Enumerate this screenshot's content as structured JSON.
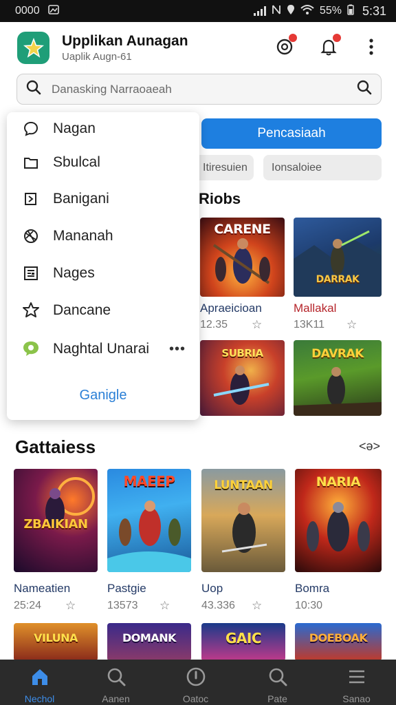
{
  "status_bar": {
    "left_text": "0000",
    "battery": "55%",
    "time": "5:31"
  },
  "header": {
    "title": "Upplikan Aunagan",
    "subtitle": "Uaplik Augn-61",
    "icons": [
      "record-icon",
      "bell-icon",
      "more-vertical-icon"
    ],
    "accent": "#1f9e78"
  },
  "search": {
    "placeholder": "Danasking Narraoaeah"
  },
  "menu": {
    "items": [
      {
        "label": "Nagan",
        "icon": "chat-bubble-icon"
      },
      {
        "label": "Sbulcal",
        "icon": "folder-icon"
      },
      {
        "label": "Banigani",
        "icon": "book-icon"
      },
      {
        "label": "Mananah",
        "icon": "gift-icon"
      },
      {
        "label": "Nages",
        "icon": "news-icon"
      },
      {
        "label": "Dancane",
        "icon": "badge-star-icon"
      },
      {
        "label": "Naghtal Unarai",
        "icon": "message-icon",
        "more": "•••"
      }
    ],
    "footer": "Ganigle"
  },
  "background_panel": {
    "primary_button": "Pencasiaah",
    "chips": [
      "Itiresuien",
      "Ionsaloiee"
    ],
    "section_title": "Riobs",
    "games": [
      {
        "name": "Apraeicioan",
        "meta": "12.35",
        "art_text": "CARENE"
      },
      {
        "name": "Mallakal",
        "meta": "13K11",
        "art_text": "DARRAK"
      },
      {
        "name": "",
        "meta": "",
        "art_text": "SUBRIA"
      },
      {
        "name": "",
        "meta": "",
        "art_text": "DAVRAK"
      }
    ]
  },
  "main_section": {
    "title": "Gattaiess",
    "more": "<ə>",
    "games": [
      {
        "name": "Nameatien",
        "meta": "25:24",
        "art_text": "ZBAIKIAN"
      },
      {
        "name": "Pastgie",
        "meta": "13573",
        "art_text": "MAEEP"
      },
      {
        "name": "Uop",
        "meta": "43.336",
        "art_text": "LUNTAAN"
      },
      {
        "name": "Bomra",
        "meta": "10:30",
        "art_text": "NARIA"
      }
    ],
    "next_row_art": [
      "VILUNA",
      "DOMANK",
      "GAIC",
      "DOEBOAK"
    ]
  },
  "bottom_nav": {
    "items": [
      {
        "label": "Nechol",
        "icon": "home-icon",
        "active": true
      },
      {
        "label": "Aanen",
        "icon": "search-icon",
        "active": false
      },
      {
        "label": "Oatoc",
        "icon": "compass-icon",
        "active": false
      },
      {
        "label": "Pate",
        "icon": "search-icon",
        "active": false
      },
      {
        "label": "Sanao",
        "icon": "menu-icon",
        "active": false
      }
    ],
    "active_color": "#3d8de8"
  }
}
